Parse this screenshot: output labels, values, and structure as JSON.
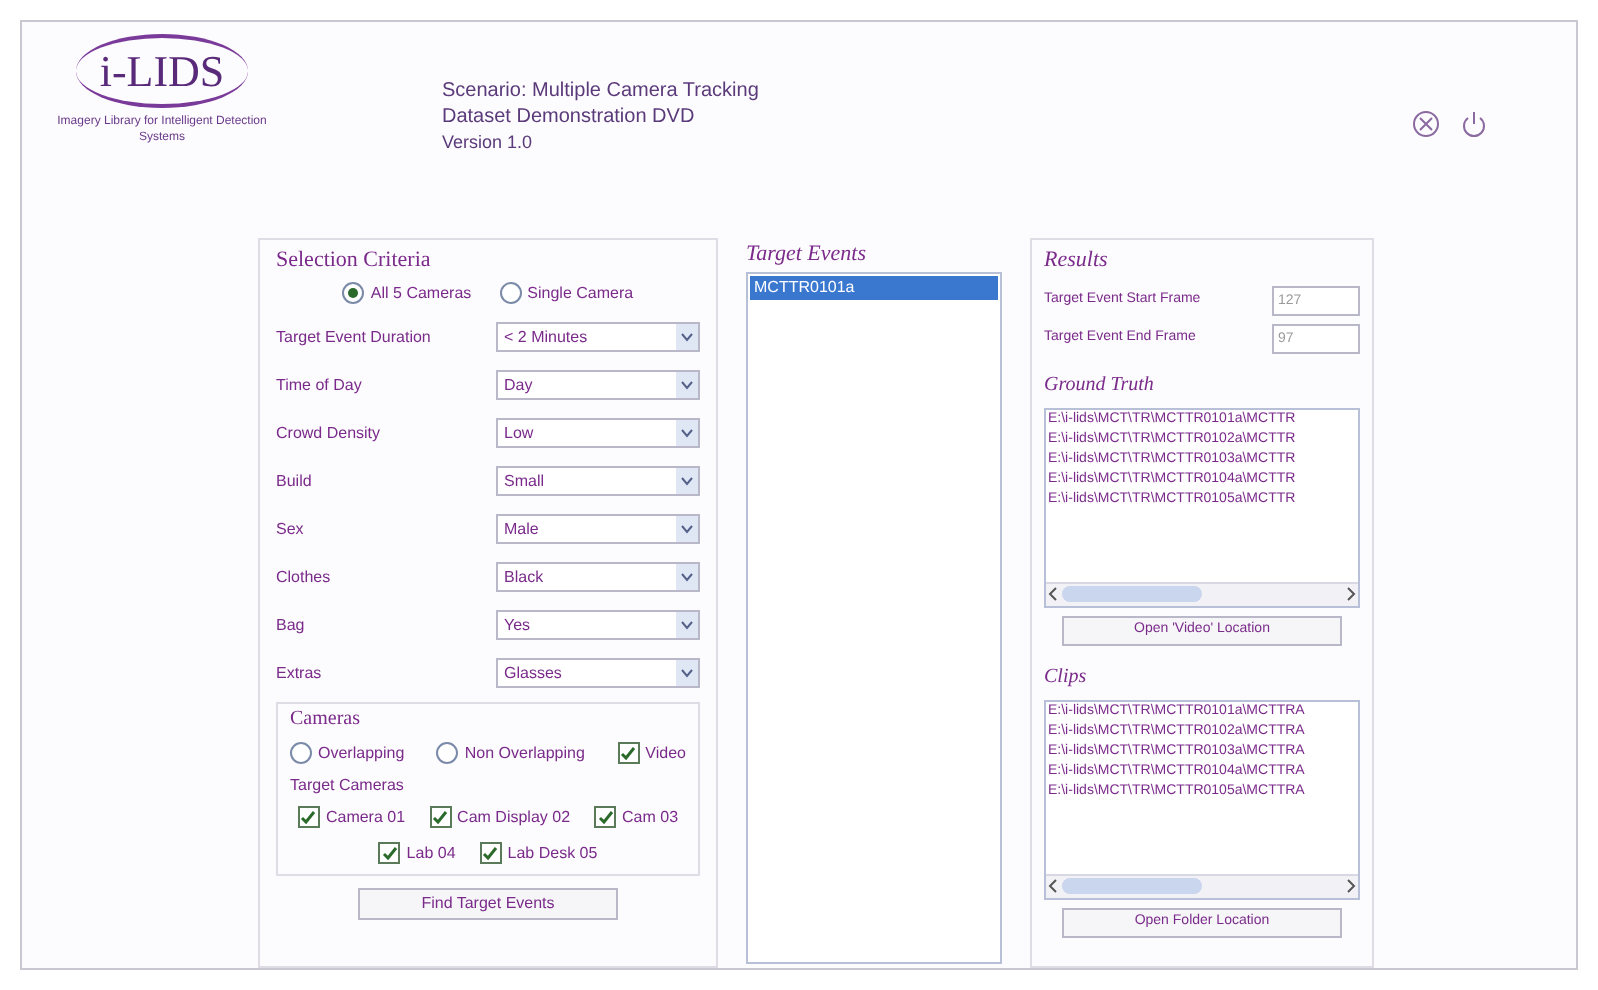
{
  "header": {
    "logo": "i-LIDS",
    "logo_caption": "Imagery Library for Intelligent Detection Systems",
    "title": "Scenario: Multiple Camera Tracking",
    "subtitle": "Dataset Demonstration DVD",
    "version": "Version 1.0"
  },
  "criteria": {
    "title": "Selection Criteria",
    "modes": [
      {
        "label": "All 5 Cameras",
        "selected": true
      },
      {
        "label": "Single Camera",
        "selected": false
      }
    ],
    "fields": [
      {
        "label": "Target Event Duration",
        "value": "< 2 Minutes"
      },
      {
        "label": "Time of Day",
        "value": "Day"
      },
      {
        "label": "Crowd Density",
        "value": "Low"
      },
      {
        "label": "Build",
        "value": "Small"
      },
      {
        "label": "Sex",
        "value": "Male"
      },
      {
        "label": "Clothes",
        "value": "Black"
      },
      {
        "label": "Bag",
        "value": "Yes"
      },
      {
        "label": "Extras",
        "value": "Glasses"
      }
    ],
    "cameras": {
      "title": "Cameras",
      "options": [
        {
          "kind": "radio",
          "label": "Overlapping",
          "checked": false
        },
        {
          "kind": "radio",
          "label": "Non Overlapping",
          "checked": false
        },
        {
          "kind": "check",
          "label": "Video",
          "checked": true
        }
      ],
      "targets_label": "Target Cameras",
      "targets": [
        {
          "label": "Camera 01",
          "checked": true
        },
        {
          "label": "Cam Display 02",
          "checked": true
        },
        {
          "label": "Cam 03",
          "checked": true
        },
        {
          "label": "Lab 04",
          "checked": true
        },
        {
          "label": "Lab Desk 05",
          "checked": true
        }
      ]
    },
    "button": "Find Target Events"
  },
  "events": {
    "title": "Target Events",
    "items": [
      {
        "label": "MCTTR0101a",
        "selected": true
      }
    ]
  },
  "results": {
    "title": "Results",
    "frames": [
      {
        "label": "Target Event Start Frame",
        "placeholder": "127"
      },
      {
        "label": "Target Event End Frame",
        "placeholder": "97"
      }
    ],
    "ground_truth": {
      "title": "Ground Truth",
      "items": [
        "E:\\i-lids\\MCT\\TR\\MCTTR0101a\\MCTTR",
        "E:\\i-lids\\MCT\\TR\\MCTTR0102a\\MCTTR",
        "E:\\i-lids\\MCT\\TR\\MCTTR0103a\\MCTTR",
        "E:\\i-lids\\MCT\\TR\\MCTTR0104a\\MCTTR",
        "E:\\i-lids\\MCT\\TR\\MCTTR0105a\\MCTTR"
      ]
    },
    "open_video": "Open 'Video' Location",
    "clips": {
      "title": "Clips",
      "items": [
        "E:\\i-lids\\MCT\\TR\\MCTTR0101a\\MCTTRA",
        "E:\\i-lids\\MCT\\TR\\MCTTR0102a\\MCTTRA",
        "E:\\i-lids\\MCT\\TR\\MCTTR0103a\\MCTTRA",
        "E:\\i-lids\\MCT\\TR\\MCTTR0104a\\MCTTRA",
        "E:\\i-lids\\MCT\\TR\\MCTTR0105a\\MCTTRA"
      ]
    },
    "open_folder": "Open Folder Location"
  }
}
